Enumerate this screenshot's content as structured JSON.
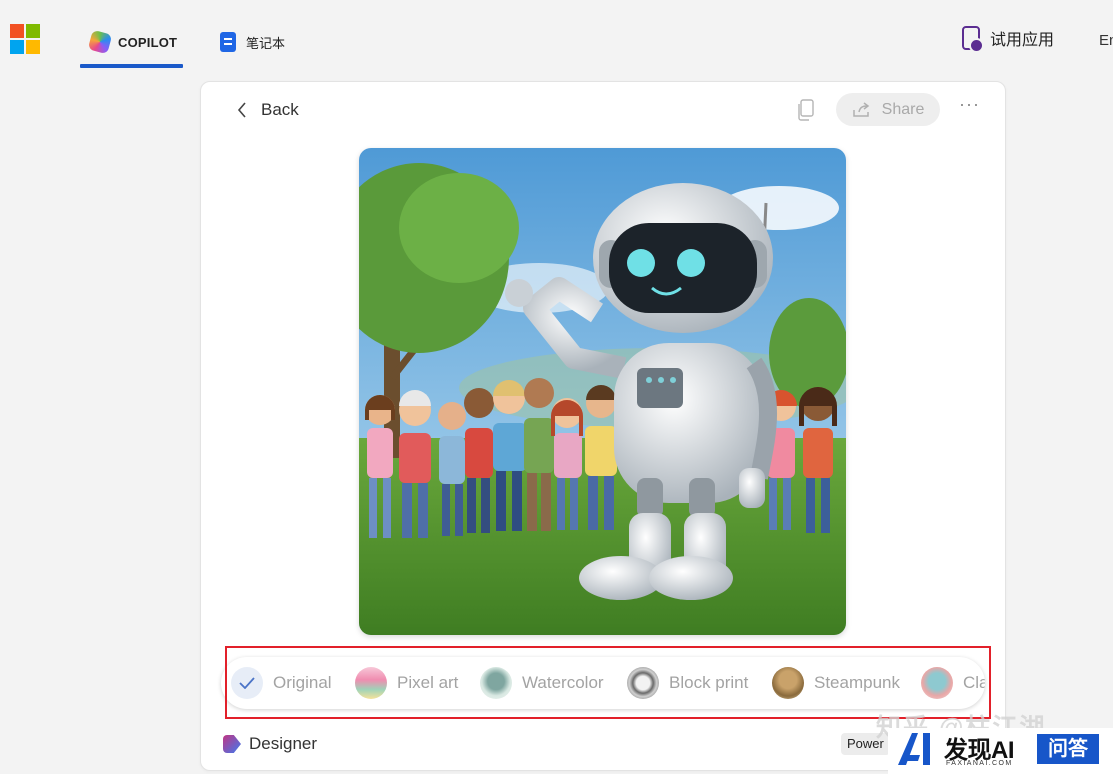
{
  "nav": {
    "tabs": [
      {
        "label": "COPILOT",
        "active": true
      },
      {
        "label": "笔记本",
        "active": false
      }
    ],
    "try_app": "试用应用",
    "language": "En"
  },
  "card": {
    "back_label": "Back",
    "share_label": "Share",
    "more_label": "···"
  },
  "styles": [
    {
      "label": "Original",
      "icon": "check-icon",
      "selected": true
    },
    {
      "label": "Pixel art",
      "icon": "pixel-art-thumbnail"
    },
    {
      "label": "Watercolor",
      "icon": "watercolor-thumbnail"
    },
    {
      "label": "Block print",
      "icon": "block-print-thumbnail"
    },
    {
      "label": "Steampunk",
      "icon": "steampunk-thumbnail"
    },
    {
      "label": "Cla",
      "icon": "claymation-thumbnail"
    }
  ],
  "footer": {
    "designer_label": "Designer",
    "powered_label": "Power"
  },
  "watermark": {
    "zhihu": "知乎 @柱江湖",
    "brand": "发现AI",
    "brand_sub": "FAXIANAI.COM",
    "qa": "问答"
  },
  "colors": {
    "accent": "#1a59c9",
    "highlight_box": "#e2202a"
  }
}
